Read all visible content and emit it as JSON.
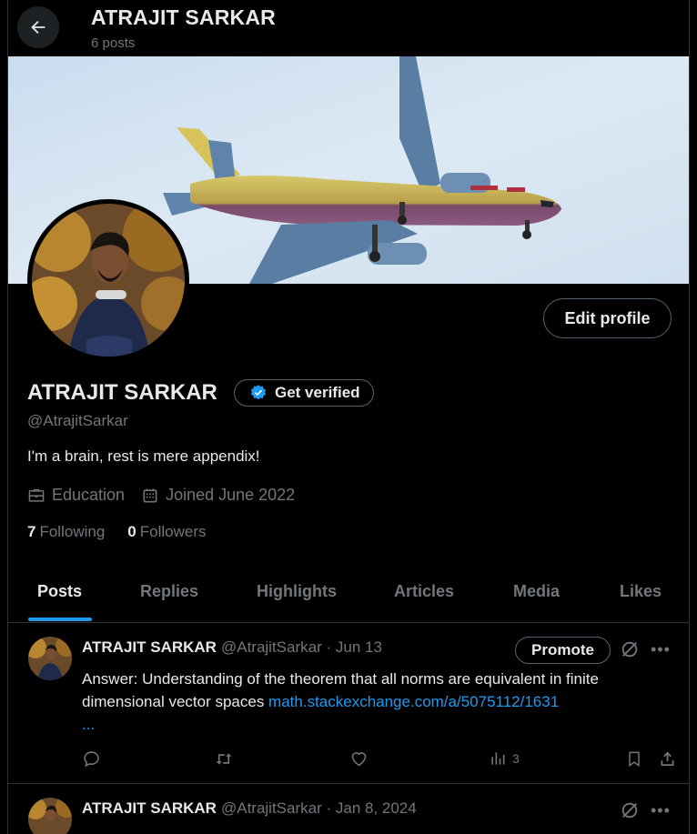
{
  "header": {
    "title": "ATRAJIT SARKAR",
    "post_count": "6 posts"
  },
  "profile": {
    "display_name": "ATRAJIT SARKAR",
    "handle": "@AtrajitSarkar",
    "bio": "I'm a brain, rest is mere appendix!",
    "category": "Education",
    "joined": "Joined June 2022",
    "following_count": "7",
    "following_label": "Following",
    "followers_count": "0",
    "followers_label": "Followers",
    "edit_button": "Edit profile",
    "verify_button": "Get verified"
  },
  "tabs": [
    {
      "label": "Posts",
      "active": true
    },
    {
      "label": "Replies"
    },
    {
      "label": "Highlights"
    },
    {
      "label": "Articles"
    },
    {
      "label": "Media"
    },
    {
      "label": "Likes"
    }
  ],
  "posts": [
    {
      "name": "ATRAJIT SARKAR",
      "handle_date": "@AtrajitSarkar · Jun 13",
      "promote": "Promote",
      "text": "Answer: Understanding of the theorem that all norms are equivalent in finite dimensional vector spaces ",
      "link": "math.stackexchange.com/a/5075112/1631",
      "link_more": "...",
      "views": "3"
    },
    {
      "name": "ATRAJIT SARKAR",
      "handle_date": "@AtrajitSarkar · Jan 8, 2024"
    }
  ],
  "colors": {
    "accent": "#1d9bf0",
    "background": "#000000",
    "muted": "#71767b"
  }
}
